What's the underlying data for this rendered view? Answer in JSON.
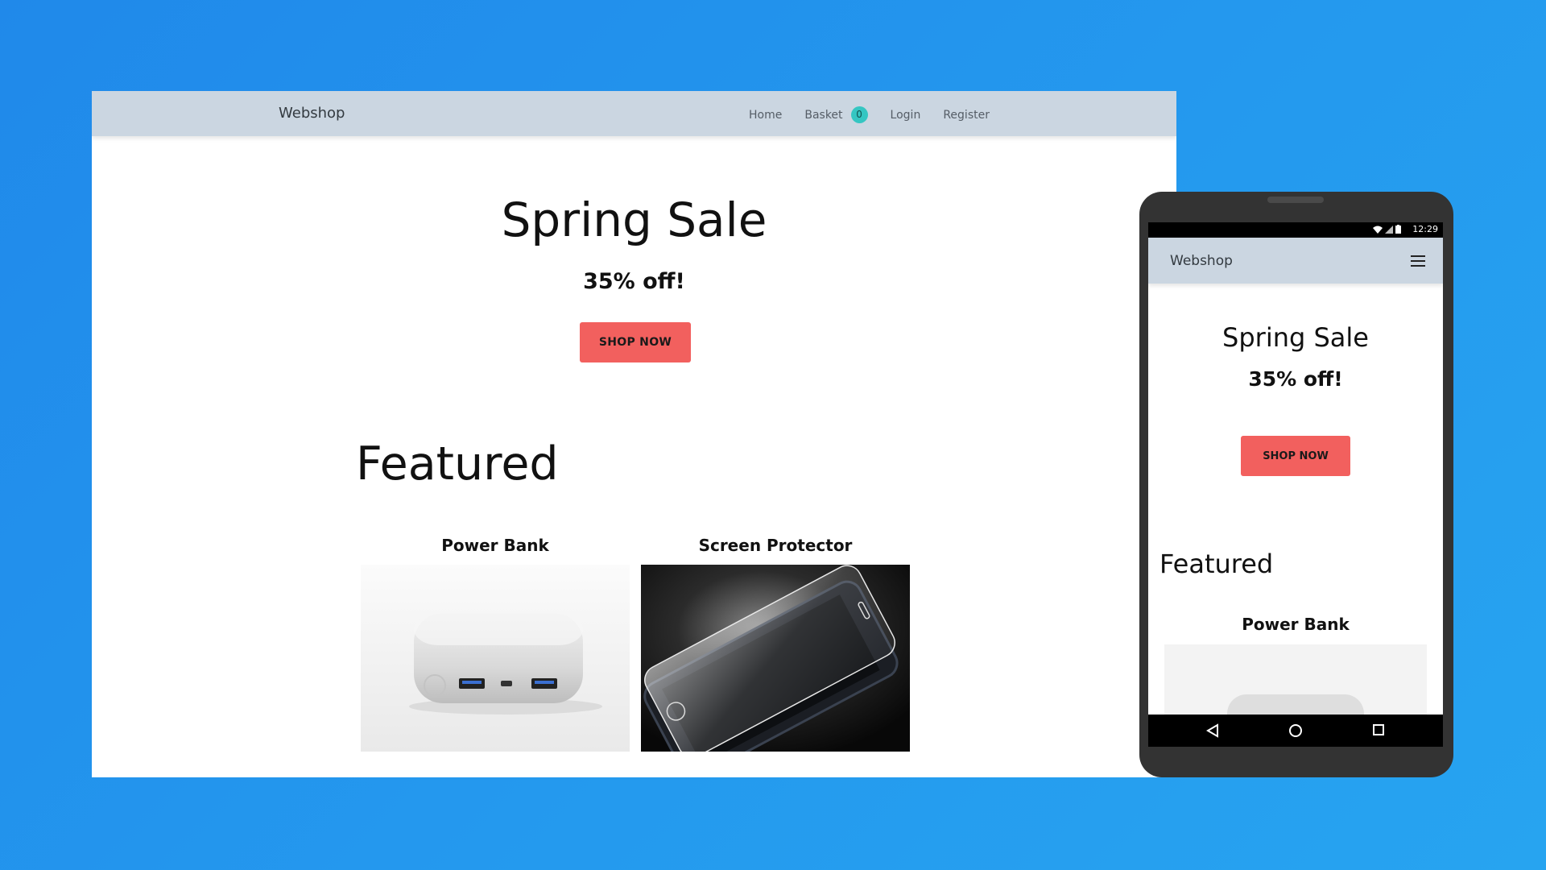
{
  "desktop": {
    "brand": "Webshop",
    "nav": {
      "home": "Home",
      "basket": "Basket",
      "basket_count": "0",
      "login": "Login",
      "register": "Register"
    },
    "hero": {
      "title": "Spring Sale",
      "subtitle": "35% off!",
      "cta": "SHOP NOW"
    },
    "featured": {
      "heading": "Featured",
      "products": [
        {
          "name": "Power Bank",
          "image": "power-bank-image"
        },
        {
          "name": "Screen Protector",
          "image": "screen-protector-image"
        }
      ]
    }
  },
  "mobile": {
    "status": {
      "time": "12:29"
    },
    "brand": "Webshop",
    "menu_icon": "hamburger-menu-icon",
    "hero": {
      "title": "Spring Sale",
      "subtitle": "35% off!",
      "cta": "SHOP NOW"
    },
    "featured": {
      "heading": "Featured",
      "first_product": "Power Bank"
    },
    "android_nav": [
      "back-icon",
      "home-icon",
      "recents-icon"
    ]
  },
  "colors": {
    "background": "#2391ec",
    "navbar": "#cbd6e1",
    "cta": "#f2605e",
    "badge": "#35c6c2",
    "phone_body": "#333333"
  }
}
